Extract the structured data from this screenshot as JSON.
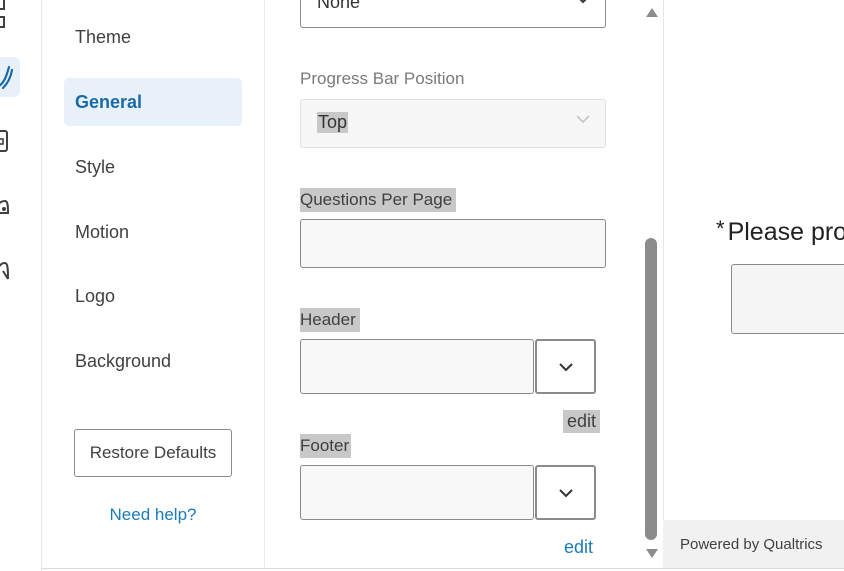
{
  "nav": {
    "items": [
      {
        "label": "Theme"
      },
      {
        "label": "General"
      },
      {
        "label": "Style"
      },
      {
        "label": "Motion"
      },
      {
        "label": "Logo"
      },
      {
        "label": "Background"
      }
    ],
    "active_index": 1,
    "restore_label": "Restore Defaults",
    "help_label": "Need help?"
  },
  "options": {
    "top_select_value": "None",
    "progress_bar_position": {
      "label": "Progress Bar Position",
      "value": "Top"
    },
    "questions_per_page": {
      "label": "Questions Per Page",
      "value": ""
    },
    "header": {
      "label": "Header",
      "value": "",
      "edit_label": "edit"
    },
    "footer": {
      "label": "Footer",
      "value": "",
      "edit_label": "edit"
    }
  },
  "preview": {
    "required_marker": "*",
    "question_text": "Please pro",
    "powered_by": "Powered by Qualtrics"
  },
  "icons": {
    "rail": [
      "layout-icon",
      "brush-icon",
      "survey-options-icon",
      "tools-icon",
      "accessibility-icon"
    ],
    "chevron": "chevron-down-icon"
  },
  "colors": {
    "accent": "#1a7bbf",
    "active_nav_bg": "#e8f1fa",
    "highlight": "#c8c8c8"
  }
}
